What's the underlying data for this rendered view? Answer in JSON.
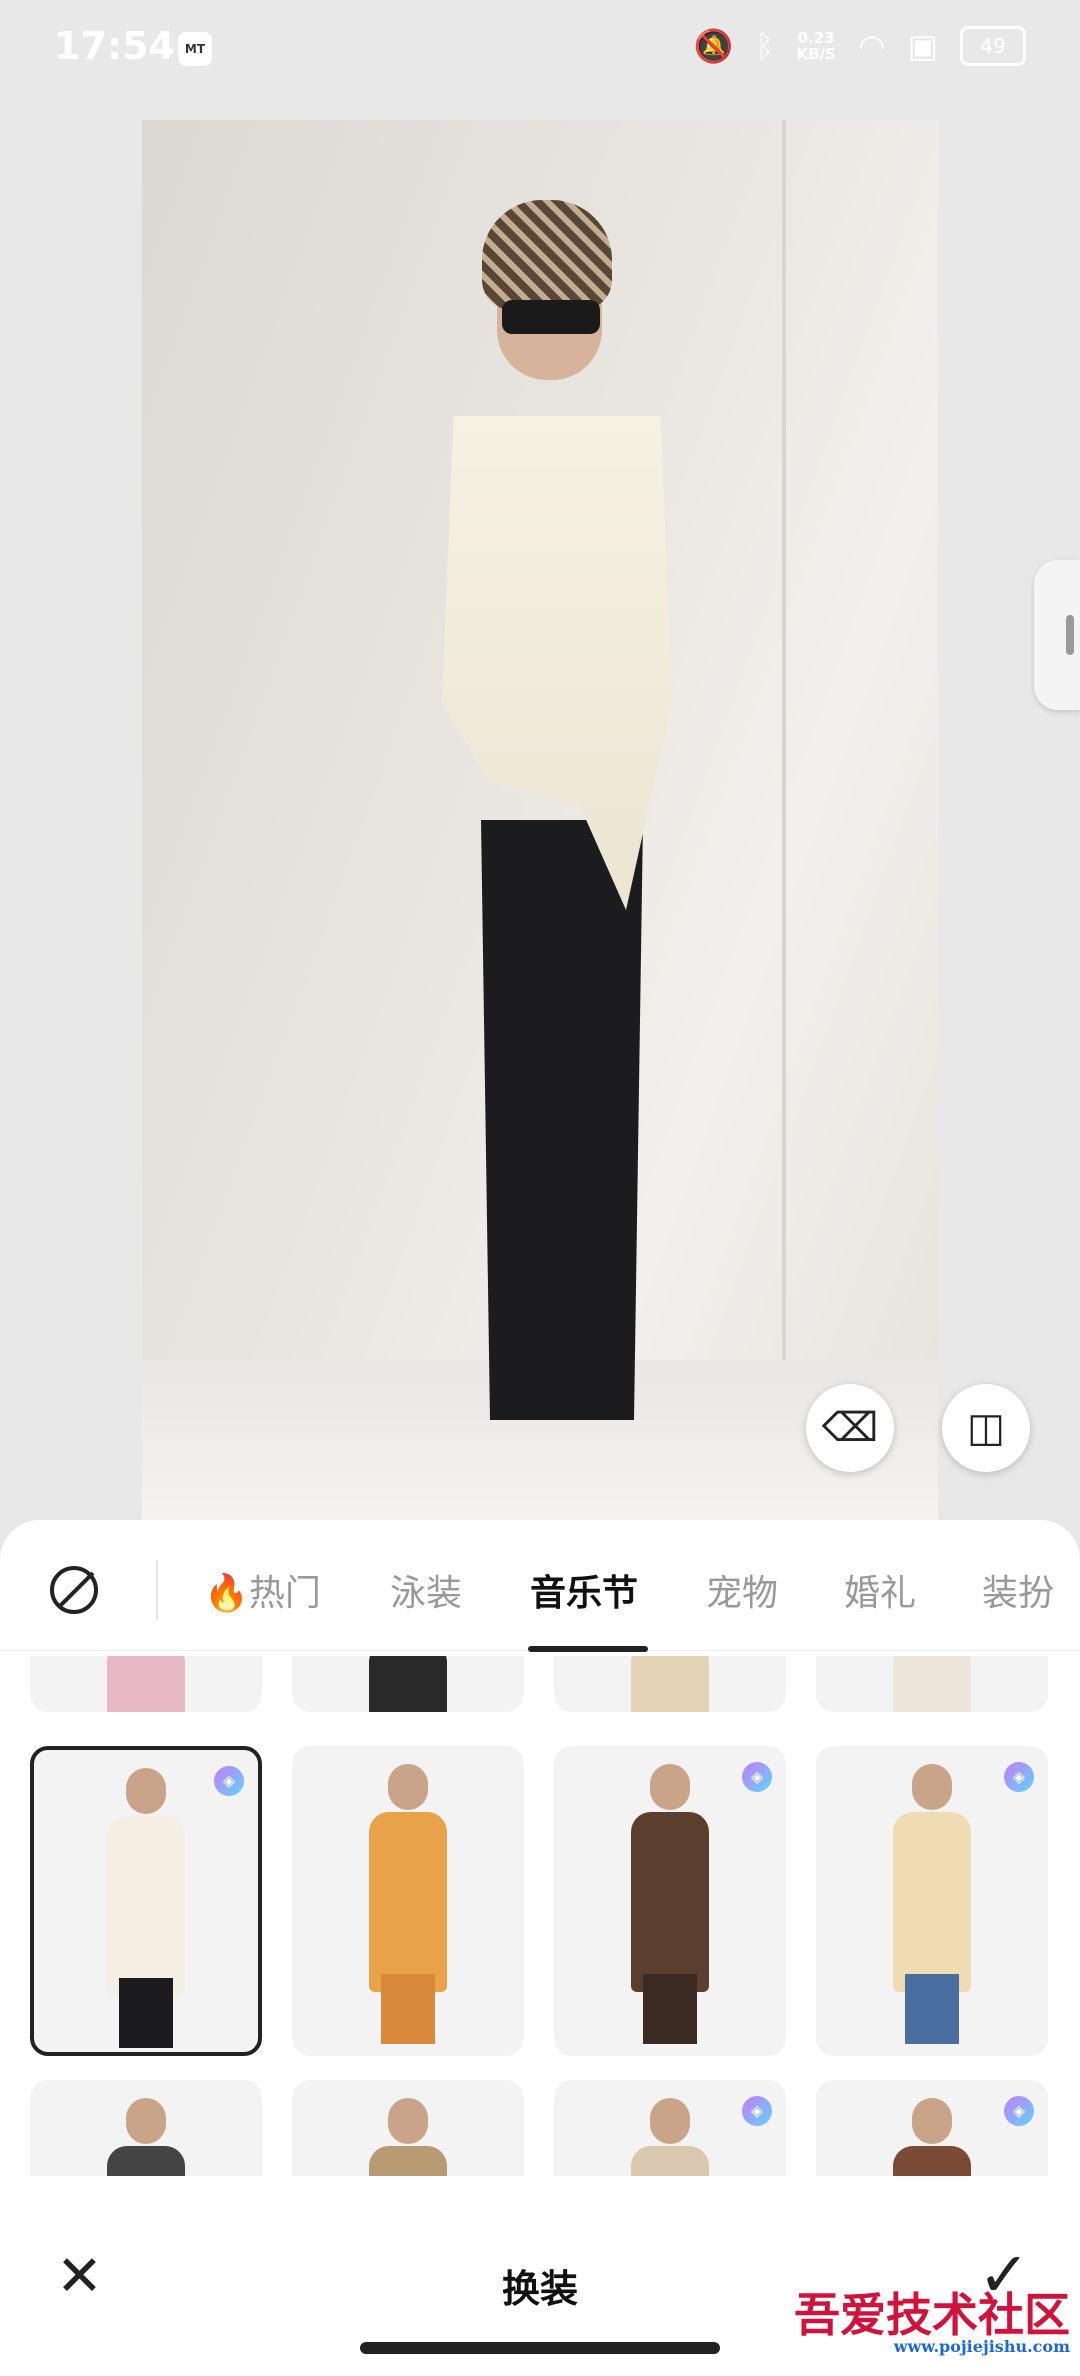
{
  "status_bar": {
    "time": "17:54",
    "app_badge": "MT",
    "net_speed": "0.23",
    "net_unit": "KB/S",
    "battery": "49",
    "icons": [
      "bell-off-icon",
      "bluetooth-icon",
      "wifi-icon",
      "sim-off-icon"
    ]
  },
  "tabs": [
    {
      "label": "🔥热门",
      "active": false
    },
    {
      "label": "泳装",
      "active": false
    },
    {
      "label": "音乐节",
      "active": true
    },
    {
      "label": "宠物",
      "active": false
    },
    {
      "label": "婚礼",
      "active": false
    },
    {
      "label": "装扮",
      "active": false
    }
  ],
  "outfits": [
    {
      "premium": false,
      "selected": false,
      "top": "#e8b9c4",
      "bottom": "#e8b9c4"
    },
    {
      "premium": false,
      "selected": false,
      "top": "#2a2a2a",
      "bottom": "#2a2a2a"
    },
    {
      "premium": false,
      "selected": false,
      "top": "#e3d3b6",
      "bottom": "#e3d3b6"
    },
    {
      "premium": false,
      "selected": false,
      "top": "#ece6da",
      "bottom": "#ece6da"
    },
    {
      "premium": true,
      "selected": true,
      "top": "#f4efe2",
      "bottom": "#1c1b1e"
    },
    {
      "premium": false,
      "selected": false,
      "top": "#e7a24a",
      "bottom": "#d88a3a"
    },
    {
      "premium": true,
      "selected": false,
      "top": "#5b3f2c",
      "bottom": "#3b2a22"
    },
    {
      "premium": true,
      "selected": false,
      "top": "#efdcb3",
      "bottom": "#4a6ea0"
    },
    {
      "premium": false,
      "selected": false,
      "top": "#444",
      "bottom": "#444"
    },
    {
      "premium": false,
      "selected": false,
      "top": "#b89a74",
      "bottom": "#b89a74"
    },
    {
      "premium": true,
      "selected": false,
      "top": "#d9c7b0",
      "bottom": "#d9c7b0"
    },
    {
      "premium": true,
      "selected": false,
      "top": "#7a4a34",
      "bottom": "#7a4a34"
    }
  ],
  "footer": {
    "title": "换装"
  },
  "watermark": {
    "text": "吾爱技术社区",
    "url": "www.pojiejishu.com"
  }
}
